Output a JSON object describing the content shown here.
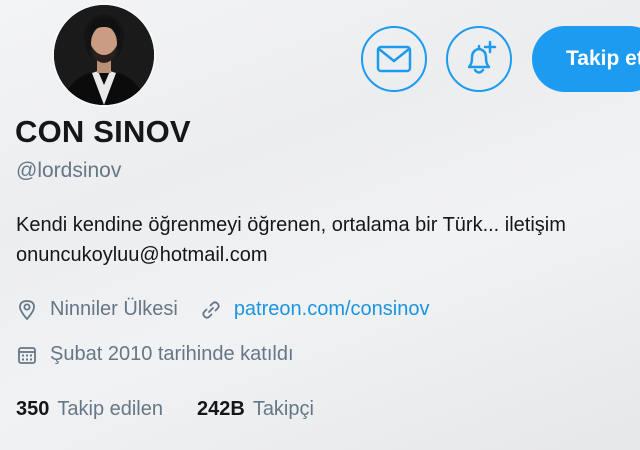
{
  "profile": {
    "display_name": "CON SINOV",
    "handle": "@lordsinov",
    "bio_line_1": "Kendi kendine öğrenmeyi öğrenen, ortalama bir Türk... iletişim",
    "bio_line_2": "onuncukoyluu@hotmail.com",
    "location": "Ninniler Ülkesi",
    "website": "patreon.com/consinov",
    "joined": "Şubat 2010 tarihinde katıldı"
  },
  "actions": {
    "message_icon": "envelope-icon",
    "notify_icon": "bell-plus-icon",
    "follow_label": "Takip et"
  },
  "stats": {
    "following_count": "350",
    "following_label": "Takip edilen",
    "followers_count": "242B",
    "followers_label": "Takipçi"
  },
  "icons": {
    "location": "location-pin-icon",
    "link": "link-icon",
    "calendar": "calendar-icon"
  },
  "colors": {
    "accent": "#1d9bf0",
    "link": "#1b95e0",
    "secondary_text": "#657786",
    "primary_text": "#14171a"
  }
}
